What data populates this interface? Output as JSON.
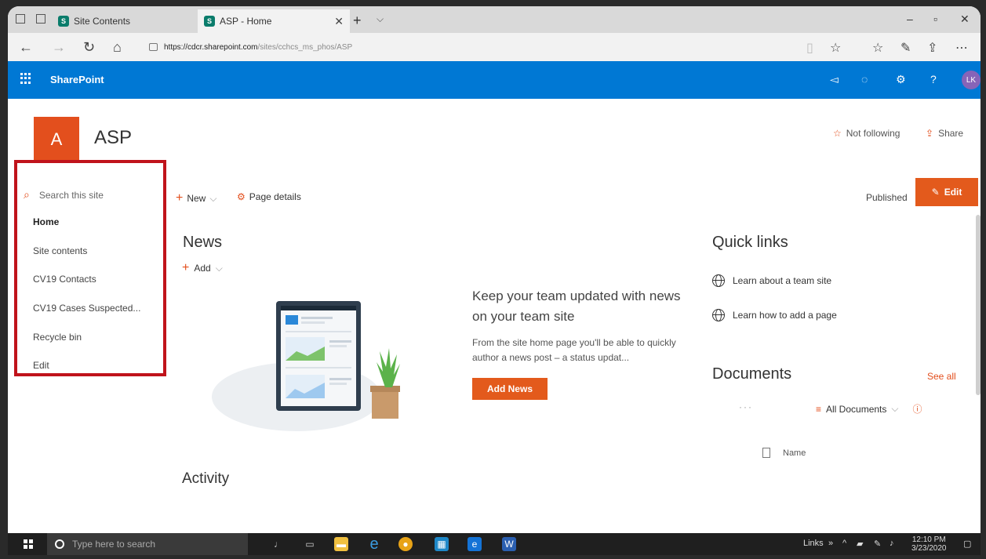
{
  "browser": {
    "tabs": [
      {
        "label": "Site Contents",
        "fav": "S"
      },
      {
        "label": "ASP - Home",
        "fav": "S"
      }
    ],
    "url_host": "https://cdcr.sharepoint.com",
    "url_path": "/sites/cchcs_ms_phos/ASP"
  },
  "suitebar": {
    "app_name": "SharePoint",
    "avatar_initials": "LK"
  },
  "site": {
    "logo_letter": "A",
    "title": "ASP",
    "follow_label": "Not following",
    "share_label": "Share"
  },
  "leftnav": {
    "search_placeholder": "Search this site",
    "items": [
      "Home",
      "Site contents",
      "CV19 Contacts",
      "CV19 Cases Suspected...",
      "Recycle bin",
      "Edit"
    ]
  },
  "commandbar": {
    "new_label": "New",
    "page_details_label": "Page details",
    "status": "Published",
    "edit_label": "Edit"
  },
  "news": {
    "title": "News",
    "add_label": "Add",
    "heading": "Keep your team updated with news on your team site",
    "description": "From the site home page you'll be able to quickly author a news post – a status updat...",
    "button_label": "Add News"
  },
  "activity": {
    "title": "Activity"
  },
  "quicklinks": {
    "title": "Quick links",
    "items": [
      "Learn about a team site",
      "Learn how to add a page"
    ]
  },
  "documents": {
    "title": "Documents",
    "see_all": "See all",
    "dots": "···",
    "view_label": "All Documents",
    "column_name": "Name"
  },
  "taskbar": {
    "search_placeholder": "Type here to search",
    "links_label": "Links",
    "time": "12:10 PM",
    "date": "3/23/2020"
  }
}
